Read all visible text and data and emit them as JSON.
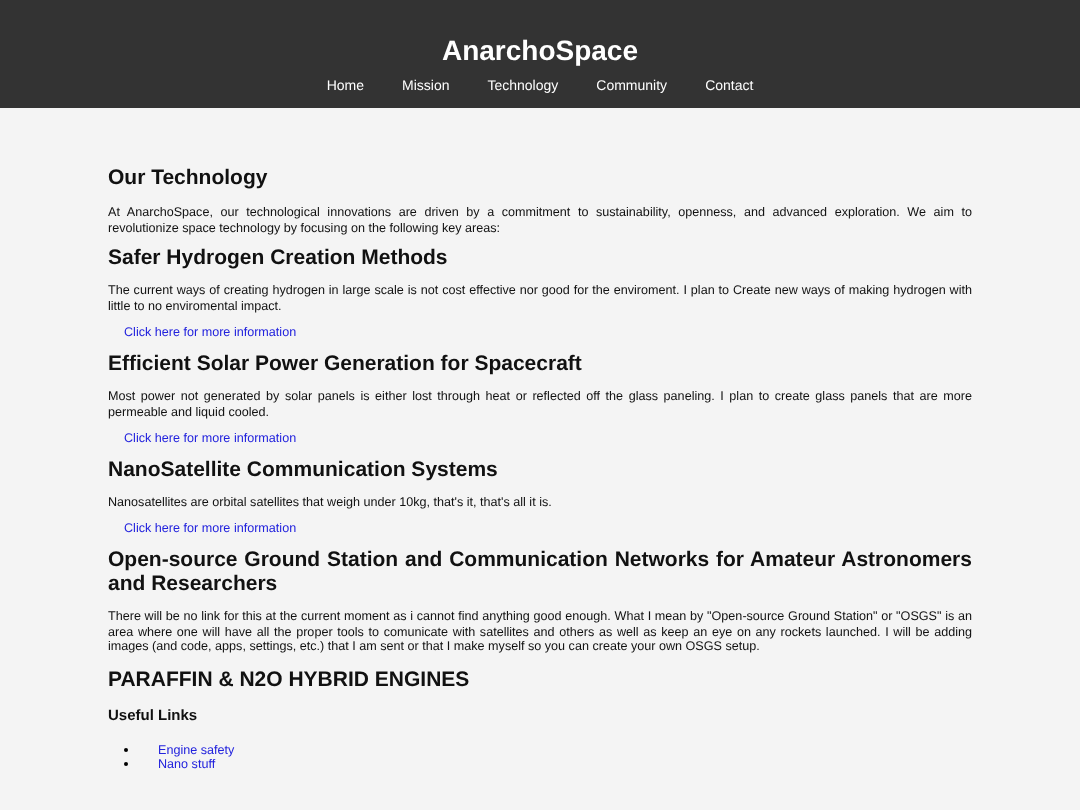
{
  "header": {
    "title": "AnarchoSpace",
    "nav": [
      "Home",
      "Mission",
      "Technology",
      "Community",
      "Contact"
    ]
  },
  "main": {
    "heading": "Our Technology",
    "intro": "At AnarchoSpace, our technological innovations are driven by a commitment to sustainability, openness, and advanced exploration. We aim to revolutionize space technology by focusing on the following key areas:",
    "sections": [
      {
        "heading": "Safer Hydrogen Creation Methods",
        "text": "The current ways of creating hydrogen in large scale is not cost effective nor good for the enviroment. I plan to Create new ways of making hydrogen with little to no enviromental impact.",
        "link": "Click here for more information"
      },
      {
        "heading": "Efficient Solar Power Generation for Spacecraft",
        "text": "Most power not generated by solar panels is either lost through heat or reflected off the glass paneling. I plan to create glass panels that are more permeable and liquid cooled.",
        "link": "Click here for more information"
      },
      {
        "heading": "NanoSatellite Communication Systems",
        "text": "Nanosatellites are orbital satellites that weigh under 10kg, that's it, that's all it is.",
        "link": "Click here for more information"
      },
      {
        "heading": "Open-source Ground Station and Communication Networks for Amateur Astronomers and Researchers",
        "text": "There will be no link for this at the current moment as i cannot find anything good enough. What I mean by \"Open-source Ground Station\" or \"OSGS\" is an area where one will have all the proper tools to comunicate with satellites and others as well as keep an eye on any rockets launched. I will be adding images (and code, apps, settings, etc.) that I am sent or that I make myself so you can create your own OSGS setup."
      },
      {
        "heading": "PARAFFIN & N2O HYBRID ENGINES"
      }
    ],
    "useful_links": {
      "heading": "Useful Links",
      "items": [
        "Engine safety",
        "Nano stuff"
      ]
    }
  }
}
